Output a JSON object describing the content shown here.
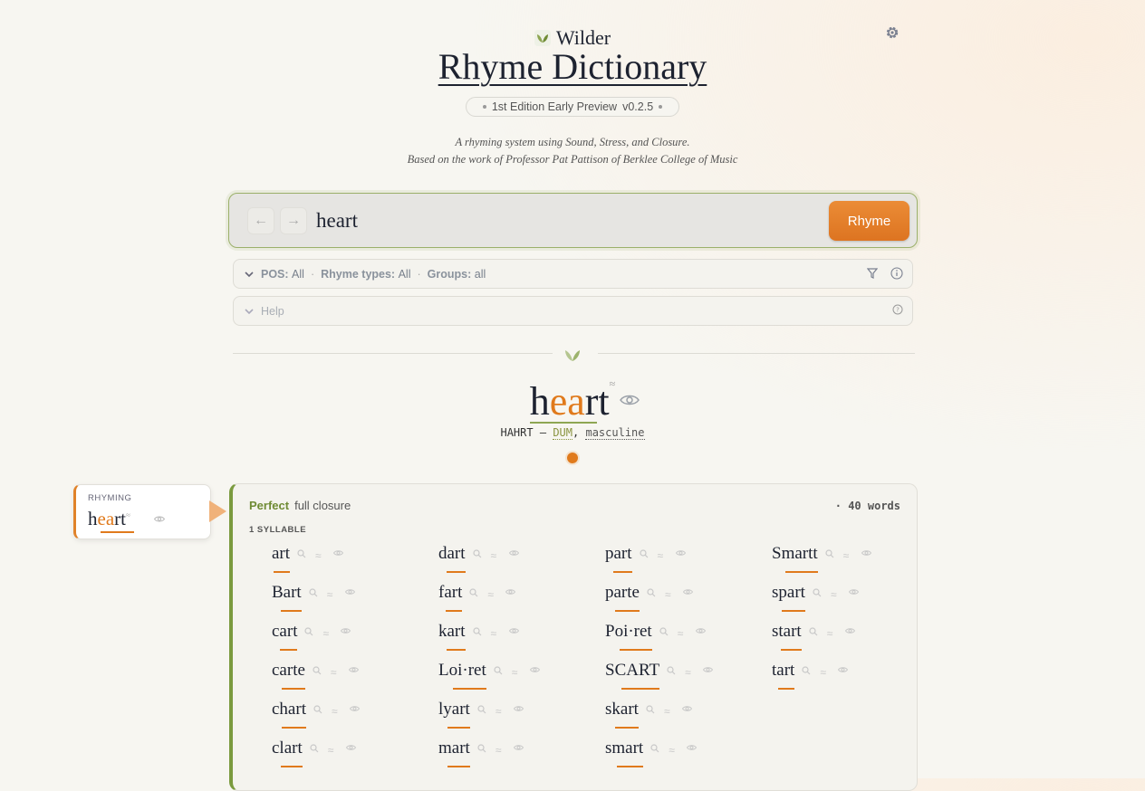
{
  "brand": {
    "name": "Wilder",
    "title": "Rhyme Dictionary",
    "edition": "1st Edition Early Preview",
    "version": "v0.2.5"
  },
  "tagline": {
    "line1": "A rhyming system using Sound, Stress, and Closure.",
    "line2": "Based on the work of Professor Pat Pattison of Berklee College of Music"
  },
  "search": {
    "value": "heart",
    "back_label": "←",
    "forward_label": "→",
    "button_label": "Rhyme"
  },
  "filters": {
    "pos_label": "POS:",
    "pos_value": "All",
    "types_label": "Rhyme types:",
    "types_value": "All",
    "groups_label": "Groups:",
    "groups_value": "all"
  },
  "help": {
    "label": "Help"
  },
  "word": {
    "pre": "h",
    "accent": "ea",
    "post": "rt",
    "marker": "≈",
    "pron": "HAHRT",
    "dash": "–",
    "stress": "DUM",
    "comma": ",",
    "ending": "masculine"
  },
  "rhyming_card": {
    "label": "RHYMING",
    "pre": "h",
    "accent": "ea",
    "post": "rt",
    "marker": "≈"
  },
  "results": {
    "type": "Perfect",
    "desc": "full closure",
    "count": "· 40 words",
    "syllable_label": "1 SYLLABLE",
    "columns": [
      [
        "art",
        "Bart",
        "cart",
        "carte",
        "chart",
        "clart"
      ],
      [
        "dart",
        "fart",
        "kart",
        "Loi·ret",
        "lyart",
        "mart"
      ],
      [
        "part",
        "parte",
        "Poi·ret",
        "SCART",
        "skart",
        "smart"
      ],
      [
        "Smartt",
        "spart",
        "start",
        "tart"
      ]
    ]
  }
}
